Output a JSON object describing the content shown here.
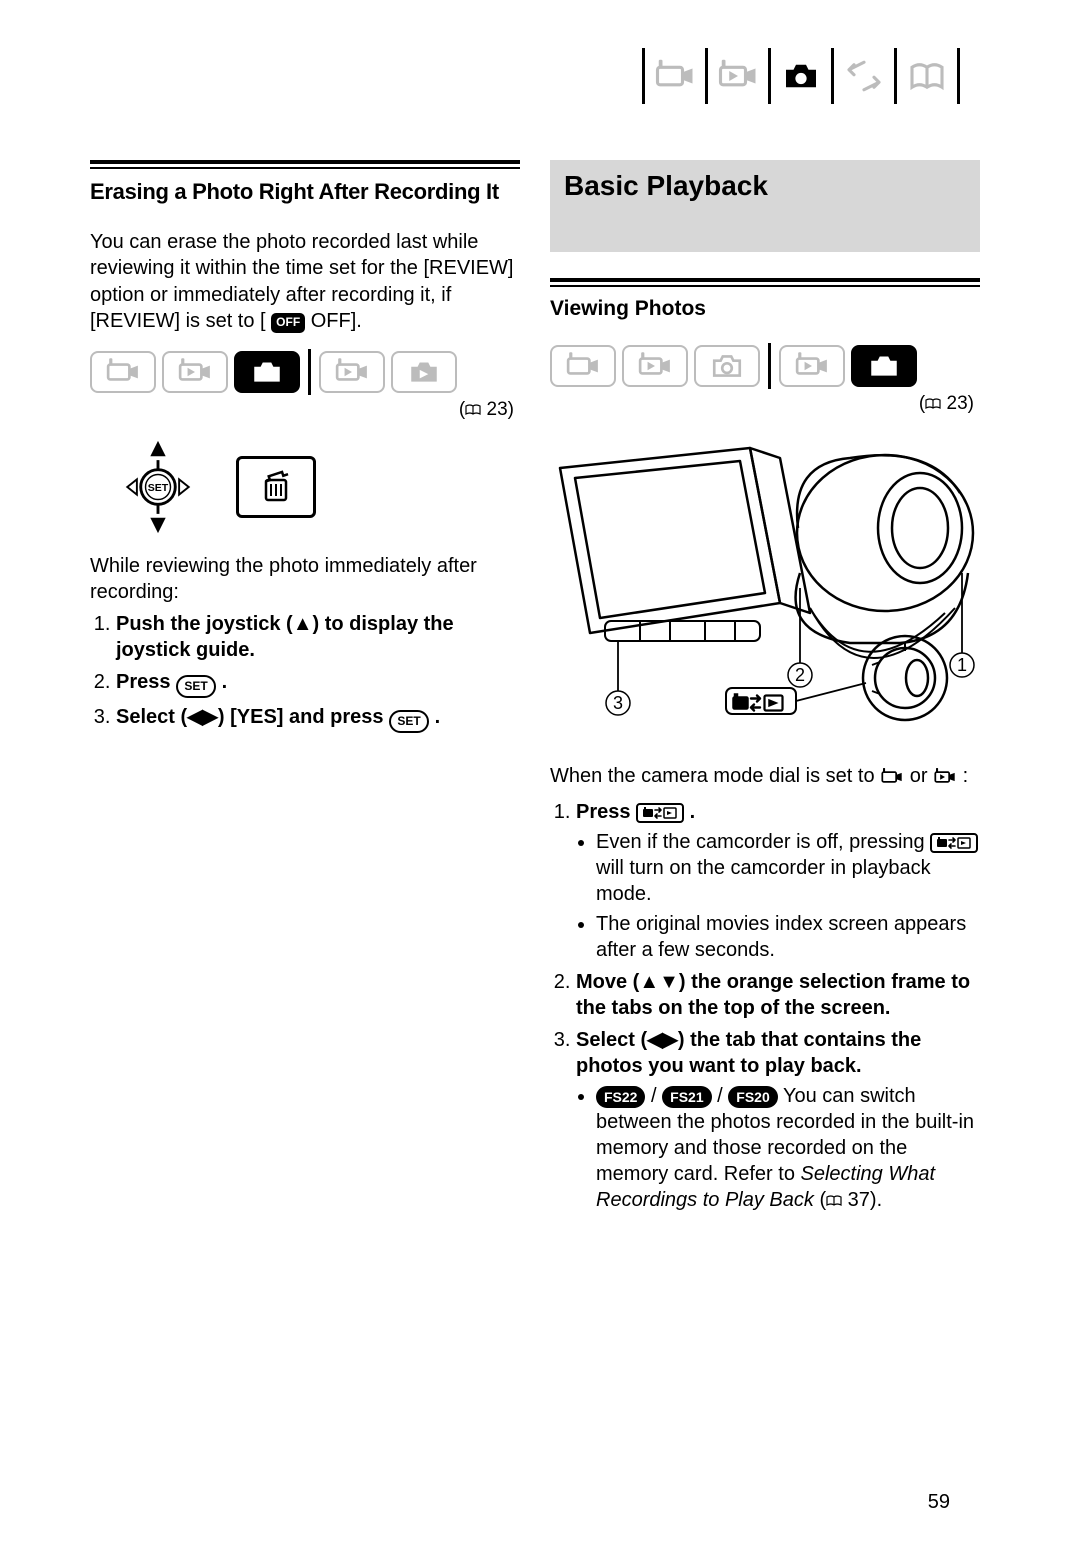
{
  "page_number": "59",
  "top_tabs": {
    "active_index": 2
  },
  "left": {
    "heading": "Erasing a Photo Right After Recording It",
    "intro_parts": {
      "p1": "You can erase the photo recorded last while reviewing it within the time set for the [REVIEW] option or immediately after recording it, if [REVIEW] is set to ",
      "off_pill": "OFF",
      "off_word": " OFF].",
      "open_bracket": "[ "
    },
    "modebar_ref": "23",
    "while_reviewing": "While reviewing the photo immediately after recording:",
    "steps": {
      "s1": "Push the joystick (▲) to display the joystick guide.",
      "s2a": "Press ",
      "s2_pill": "SET",
      "s2b": " .",
      "s3a": "Select (◀▶) [YES] and press ",
      "s3_pill": "SET",
      "s3b": " ."
    }
  },
  "right": {
    "banner": "Basic Playback",
    "subheading": "Viewing Photos",
    "modebar_ref": "23",
    "callouts": {
      "one": "1",
      "two": "2",
      "three": "3"
    },
    "when_dial": "When the camera mode dial is set to ",
    "when_dial_tail": " :",
    "when_dial_or": " or ",
    "steps": {
      "s1_a": "Press ",
      "s1_b": " .",
      "s1_pill_title": "play-mode-button",
      "s1_sub1_a": "Even if the camcorder is off, pressing ",
      "s1_sub1_b": " will turn on the camcorder in playback mode.",
      "s1_sub2": "The original movies index screen appears after a few seconds.",
      "s2": "Move (▲▼) the orange selection frame to the tabs on the top of the screen.",
      "s3": "Select (◀▶) the tab that contains the photos you want to play back.",
      "s3_sub_models": {
        "a": "FS22",
        "b": "FS21",
        "c": "FS20"
      },
      "s3_sub_text": "  You can switch between the photos recorded in the built-in memory and those recorded on the memory card. Refer to ",
      "s3_sub_italic": "Selecting What Recordings to Play Back",
      "s3_sub_ref": "37",
      "s3_sub_tail1": " (",
      "s3_sub_tail2": ")."
    }
  }
}
